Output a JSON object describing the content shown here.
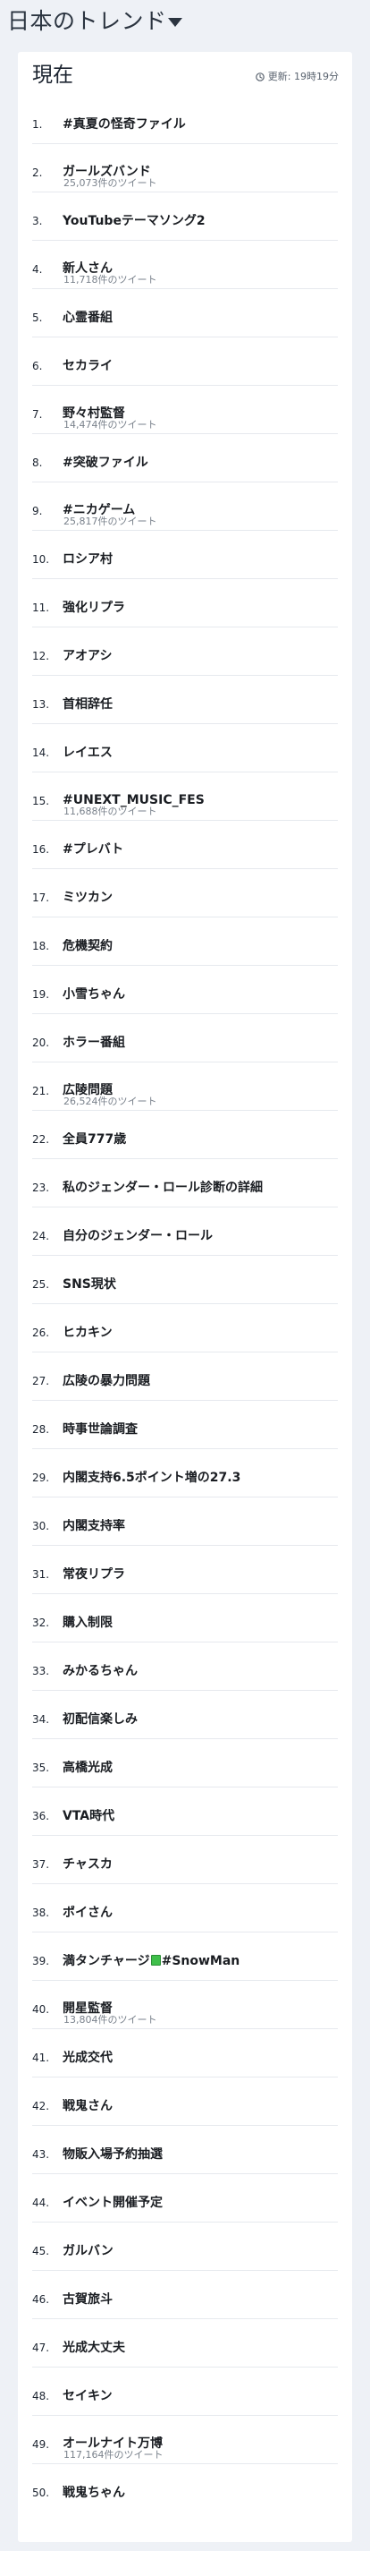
{
  "header": {
    "title": "日本のトレンド",
    "caret_icon": "chevron-down-icon"
  },
  "card": {
    "title": "現在",
    "updated_icon": "clock-icon",
    "updated_text": "更新: 19時19分"
  },
  "trends": [
    {
      "rank": "1.",
      "name": "#真夏の怪奇ファイル",
      "count": ""
    },
    {
      "rank": "2.",
      "name": "ガールズバンド",
      "count": "25,073件のツイート"
    },
    {
      "rank": "3.",
      "name": "YouTubeテーマソング2",
      "count": ""
    },
    {
      "rank": "4.",
      "name": "新人さん",
      "count": "11,718件のツイート"
    },
    {
      "rank": "5.",
      "name": "心霊番組",
      "count": ""
    },
    {
      "rank": "6.",
      "name": "セカライ",
      "count": ""
    },
    {
      "rank": "7.",
      "name": "野々村監督",
      "count": "14,474件のツイート"
    },
    {
      "rank": "8.",
      "name": "#突破ファイル",
      "count": ""
    },
    {
      "rank": "9.",
      "name": "#ニカゲーム",
      "count": "25,817件のツイート"
    },
    {
      "rank": "10.",
      "name": "ロシア村",
      "count": ""
    },
    {
      "rank": "11.",
      "name": "強化リプラ",
      "count": ""
    },
    {
      "rank": "12.",
      "name": "アオアシ",
      "count": ""
    },
    {
      "rank": "13.",
      "name": "首相辞任",
      "count": ""
    },
    {
      "rank": "14.",
      "name": "レイエス",
      "count": ""
    },
    {
      "rank": "15.",
      "name": "#UNEXT_MUSIC_FES",
      "count": "11,688件のツイート"
    },
    {
      "rank": "16.",
      "name": "#プレバト",
      "count": ""
    },
    {
      "rank": "17.",
      "name": "ミツカン",
      "count": ""
    },
    {
      "rank": "18.",
      "name": "危機契約",
      "count": ""
    },
    {
      "rank": "19.",
      "name": "小雪ちゃん",
      "count": ""
    },
    {
      "rank": "20.",
      "name": "ホラー番組",
      "count": ""
    },
    {
      "rank": "21.",
      "name": "広陵問題",
      "count": "26,524件のツイート"
    },
    {
      "rank": "22.",
      "name": "全員777歳",
      "count": ""
    },
    {
      "rank": "23.",
      "name": "私のジェンダー・ロール診断の詳細",
      "count": ""
    },
    {
      "rank": "24.",
      "name": "自分のジェンダー・ロール",
      "count": ""
    },
    {
      "rank": "25.",
      "name": "SNS現状",
      "count": ""
    },
    {
      "rank": "26.",
      "name": "ヒカキン",
      "count": ""
    },
    {
      "rank": "27.",
      "name": "広陵の暴力問題",
      "count": ""
    },
    {
      "rank": "28.",
      "name": "時事世論調査",
      "count": ""
    },
    {
      "rank": "29.",
      "name": "内閣支持6.5ポイント増の27.3",
      "count": ""
    },
    {
      "rank": "30.",
      "name": "内閣支持率",
      "count": ""
    },
    {
      "rank": "31.",
      "name": "常夜リプラ",
      "count": ""
    },
    {
      "rank": "32.",
      "name": "購入制限",
      "count": ""
    },
    {
      "rank": "33.",
      "name": "みかるちゃん",
      "count": ""
    },
    {
      "rank": "34.",
      "name": "初配信楽しみ",
      "count": ""
    },
    {
      "rank": "35.",
      "name": "高橋光成",
      "count": ""
    },
    {
      "rank": "36.",
      "name": "VTA時代",
      "count": ""
    },
    {
      "rank": "37.",
      "name": "チャスカ",
      "count": ""
    },
    {
      "rank": "38.",
      "name": "ポイさん",
      "count": ""
    },
    {
      "rank": "39.",
      "name_before": "満タンチャージ",
      "name_after": "#SnowMan",
      "emoji": "battery-emoji",
      "count": ""
    },
    {
      "rank": "40.",
      "name": "開星監督",
      "count": "13,804件のツイート"
    },
    {
      "rank": "41.",
      "name": "光成交代",
      "count": ""
    },
    {
      "rank": "42.",
      "name": "戦鬼さん",
      "count": ""
    },
    {
      "rank": "43.",
      "name": "物販入場予約抽選",
      "count": ""
    },
    {
      "rank": "44.",
      "name": "イベント開催予定",
      "count": ""
    },
    {
      "rank": "45.",
      "name": "ガルバン",
      "count": ""
    },
    {
      "rank": "46.",
      "name": "古賀旅斗",
      "count": ""
    },
    {
      "rank": "47.",
      "name": "光成大丈夫",
      "count": ""
    },
    {
      "rank": "48.",
      "name": "セイキン",
      "count": ""
    },
    {
      "rank": "49.",
      "name": "オールナイト万博",
      "count": "117,164件のツイート"
    },
    {
      "rank": "50.",
      "name": "戦鬼ちゃん",
      "count": ""
    }
  ]
}
